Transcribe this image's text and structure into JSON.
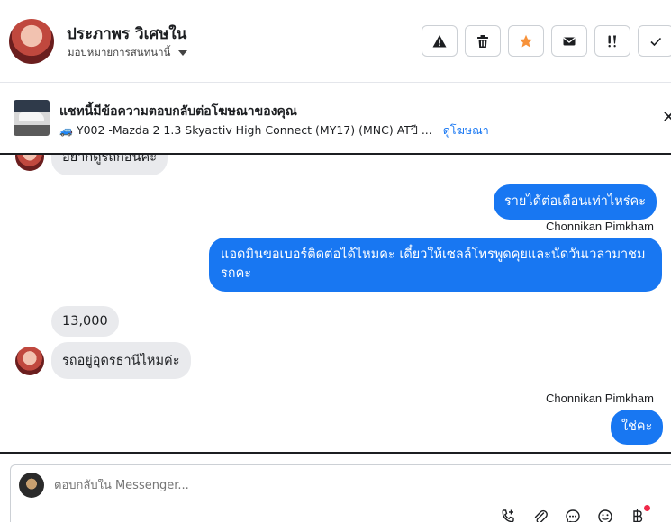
{
  "header": {
    "contact_name": "ประภาพร วิเศษใน",
    "assign_label": "มอบหมายการสนทนานี้",
    "actions": [
      {
        "name": "warning-icon",
        "glyph": "⚠"
      },
      {
        "name": "trash-icon",
        "glyph": ""
      },
      {
        "name": "star-icon",
        "glyph": "★",
        "color": "#f7923a"
      },
      {
        "name": "mail-icon",
        "glyph": ""
      },
      {
        "name": "important-icon",
        "glyph": "!!"
      },
      {
        "name": "check-icon",
        "glyph": "✓"
      }
    ]
  },
  "ad": {
    "title": "แชทนี้มีข้อความตอบกลับต่อโฆษณาของคุณ",
    "subtitle": "Y002 -Mazda 2 1.3 Skyactiv High Connect (MY17) (MNC) ATปี ...",
    "link": "ดูโฆษณา",
    "close": "✕"
  },
  "messages": {
    "m0": "อยากดูรถก่อนค่ะ",
    "m1": "รายได้ต่อเดือนเท่าไหร่คะ",
    "m1_sender": "Chonnikan Pimkham",
    "m2": "แอดมินขอเบอร์ติดต่อได้ไหมคะ เดี๋ยวให้เซลล์โทรพูดคุยและนัดวันเวลามาชมรถคะ",
    "m3": "13,000",
    "m4": "รถอยู่อุดรธานีไหมค่ะ",
    "m5_sender": "Chonnikan Pimkham",
    "m5": "ใช่คะ"
  },
  "composer": {
    "placeholder": "ตอบกลับใน Messenger..."
  },
  "colors": {
    "accent": "#1877f2",
    "incoming_bubble": "#e9eaed",
    "star": "#f7923a",
    "notification": "#f02849"
  }
}
